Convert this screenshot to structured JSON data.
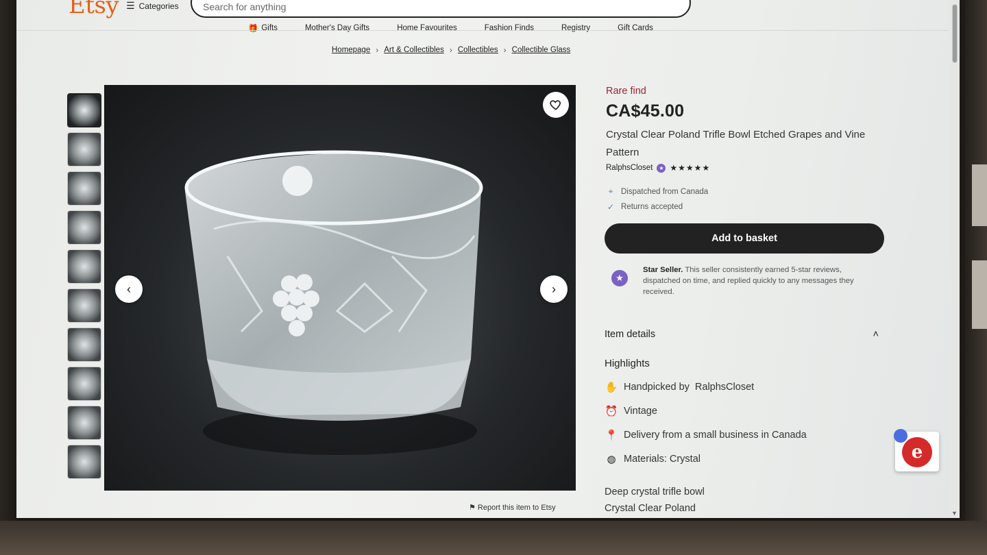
{
  "header": {
    "logo": "Etsy",
    "categories_label": "Categories",
    "search_placeholder": "Search for anything"
  },
  "nav": [
    {
      "label": "Gifts",
      "icon": "gift-icon"
    },
    {
      "label": "Mother's Day Gifts"
    },
    {
      "label": "Home Favourites"
    },
    {
      "label": "Fashion Finds"
    },
    {
      "label": "Registry"
    },
    {
      "label": "Gift Cards"
    }
  ],
  "breadcrumb": [
    "Homepage",
    "Art & Collectibles",
    "Collectibles",
    "Collectible Glass"
  ],
  "gallery": {
    "thumbnail_count": 10,
    "report_label": "Report this item to Etsy"
  },
  "listing": {
    "rare_label": "Rare find",
    "price": "CA$45.00",
    "title": "Crystal Clear Poland Trifle Bowl Etched Grapes and Vine Pattern",
    "shop_name": "RalphsCloset",
    "rating_stars": "★★★★★",
    "dispatched": "Dispatched from Canada",
    "returns": "Returns accepted",
    "add_to_basket": "Add to basket",
    "star_seller_title": "Star Seller.",
    "star_seller_text": "This seller consistently earned 5-star reviews, dispatched on time, and replied quickly to any messages they received."
  },
  "details": {
    "section_title": "Item details",
    "highlights_title": "Highlights",
    "handpicked_prefix": "Handpicked by",
    "handpicked_shop": "RalphsCloset",
    "vintage": "Vintage",
    "delivery": "Delivery from a small business in Canada",
    "materials": "Materials: Crystal",
    "description_1": "Deep crystal trifle bowl",
    "description_2": "Crystal Clear Poland"
  },
  "colors": {
    "brand": "#e0631c",
    "rare": "#9b2335",
    "star_seller": "#7b61c4",
    "button": "#222222"
  }
}
